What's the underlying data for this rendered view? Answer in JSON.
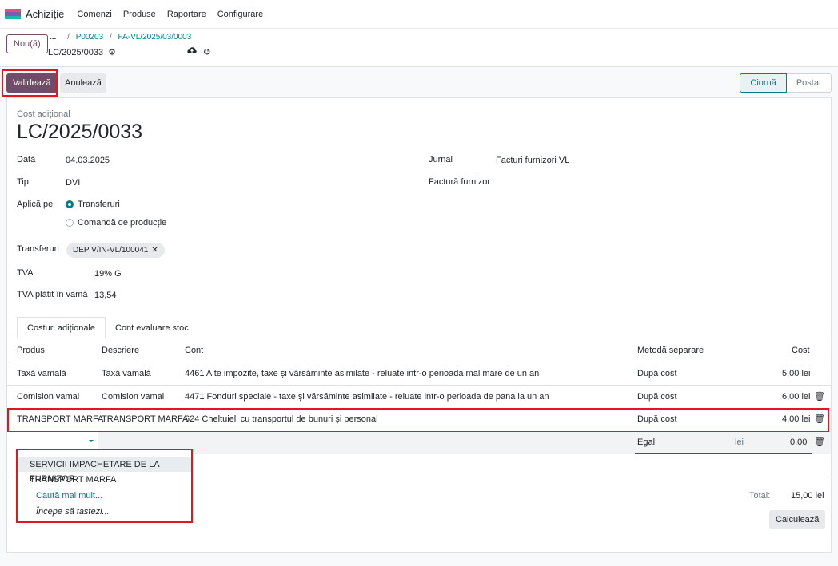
{
  "nav": {
    "app_name": "Achiziție",
    "items": [
      "Comenzi",
      "Produse",
      "Raportare",
      "Configurare"
    ],
    "icon_colors": [
      "#e64e7a",
      "#7d5ca8",
      "#21b5a7"
    ]
  },
  "control_panel": {
    "new_label": "Nou(ă)",
    "breadcrumb_dots": "...",
    "breadcrumbs": [
      "P00203",
      "FA-VL/2025/03/0003"
    ],
    "record_name": "LC/2025/0033"
  },
  "statusbar": {
    "validate_label": "Validează",
    "cancel_label": "Anulează",
    "stages": [
      "Ciornă",
      "Postat"
    ]
  },
  "form": {
    "subtitle": "Cost adițional",
    "title": "LC/2025/0033",
    "fields": {
      "data_label": "Dată",
      "data_value": "04.03.2025",
      "tip_label": "Tip",
      "tip_value": "DVI",
      "aplica_label": "Aplică pe",
      "aplica_opt1": "Transferuri",
      "aplica_opt2": "Comandă de producție",
      "jurnal_label": "Jurnal",
      "jurnal_value": "Facturi furnizori VL",
      "factura_label": "Factură furnizor",
      "transferuri_label": "Transferuri",
      "transferuri_tag": "DEP V/IN-VL/100041",
      "tva_label": "TVA",
      "tva_value": "19% G",
      "tva_vama_label": "TVA plătit în vamă",
      "tva_vama_value": "13,54"
    },
    "tabs": [
      "Costuri adiționale",
      "Cont evaluare stoc"
    ],
    "columns": [
      "Produs",
      "Descriere",
      "Cont",
      "Metodă separare",
      "Cost"
    ],
    "rows": [
      {
        "produs": "Taxă vamală",
        "descriere": "Taxă vamală",
        "cont": "4461 Alte impozite, taxe și vărsăminte asimilate - reluate intr-o perioada mal mare de un an",
        "metoda": "După cost",
        "cost": "5,00 lei"
      },
      {
        "produs": "Comision vamal",
        "descriere": "Comision vamal",
        "cont": "4471 Fonduri speciale - taxe și vărsăminte asimilate - reluate intr-o perioada de pana la un an",
        "metoda": "După cost",
        "cost": "6,00 lei"
      },
      {
        "produs": "TRANSPORT MARFA",
        "descriere": "TRANSPORT MARFA",
        "cont": "624 Cheltuieli cu transportul de bunuri și personal",
        "metoda": "După cost",
        "cost": "4,00 lei"
      }
    ],
    "new_row": {
      "metoda": "Egal",
      "currency": "lei",
      "cost": "0,00"
    },
    "dropdown": {
      "items": [
        "SERVICII IMPACHETARE DE LA FURNIZOR",
        "TRANSPORT MARFA"
      ],
      "search_more": "Caută mai mult...",
      "start_typing": "Începe să tastezi..."
    },
    "total_label": "Total:",
    "total_value": "15,00 lei",
    "calc_label": "Calculează"
  }
}
